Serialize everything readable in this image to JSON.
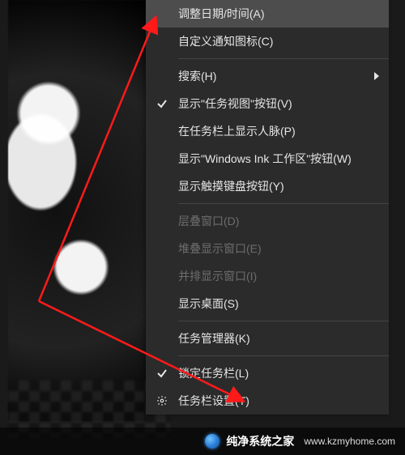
{
  "menu": {
    "adjust_datetime": "调整日期/时间(A)",
    "customize_icons": "自定义通知图标(C)",
    "search": "搜索(H)",
    "show_taskview_btn": "显示\"任务视图\"按钮(V)",
    "show_people": "在任务栏上显示人脉(P)",
    "show_ink": "显示\"Windows Ink 工作区\"按钮(W)",
    "show_touchkb": "显示触摸键盘按钮(Y)",
    "cascade": "层叠窗口(D)",
    "stacked": "堆叠显示窗口(E)",
    "sidebyside": "并排显示窗口(I)",
    "show_desktop": "显示桌面(S)",
    "task_manager": "任务管理器(K)",
    "lock_taskbar": "锁定任务栏(L)",
    "taskbar_settings": "任务栏设置(T)"
  },
  "watermark": {
    "brand": "纯净系统之家",
    "url": "www.kzmyhome.com"
  }
}
